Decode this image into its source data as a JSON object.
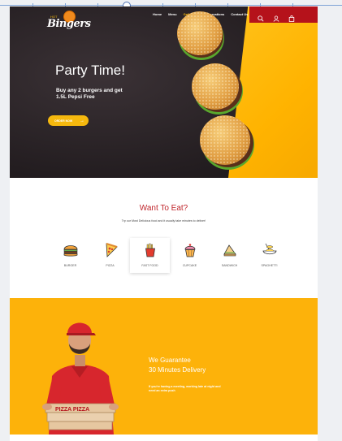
{
  "brand": {
    "name": "Bingers",
    "small": "HOT",
    "accent": "#f5b80e",
    "red": "#b5121b"
  },
  "nav": {
    "items": [
      "Home",
      "Menu",
      "Gallery",
      "Reservations",
      "Contact Us"
    ],
    "active_index": 2
  },
  "header_icons": [
    "search-icon",
    "user-icon",
    "bag-icon"
  ],
  "hero": {
    "title": "Party Time!",
    "subtitle": "Buy any 2 burgers and get 1.5L Pepsi Free",
    "button_label": "ORDER NOW"
  },
  "want": {
    "title": "Want To Eat?",
    "subtitle": "Try our Most Delicious food and it usually take minutes to deliver!",
    "categories": [
      {
        "label": "BURGER",
        "icon": "burger-icon"
      },
      {
        "label": "PIZZA",
        "icon": "pizza-icon"
      },
      {
        "label": "FAST FOOD",
        "icon": "fries-icon"
      },
      {
        "label": "CUPCAKE",
        "icon": "cupcake-icon"
      },
      {
        "label": "SANDWICH",
        "icon": "sandwich-icon"
      },
      {
        "label": "SPAGHETTI",
        "icon": "spaghetti-icon"
      }
    ],
    "selected_index": 2
  },
  "guarantee": {
    "title_line1": "We Guarantee",
    "title_line2": "30 Minutes Delivery",
    "text": "If you're having a meeting, working late at night and need an extra push",
    "box_text": "PIZZA PIZZA"
  }
}
